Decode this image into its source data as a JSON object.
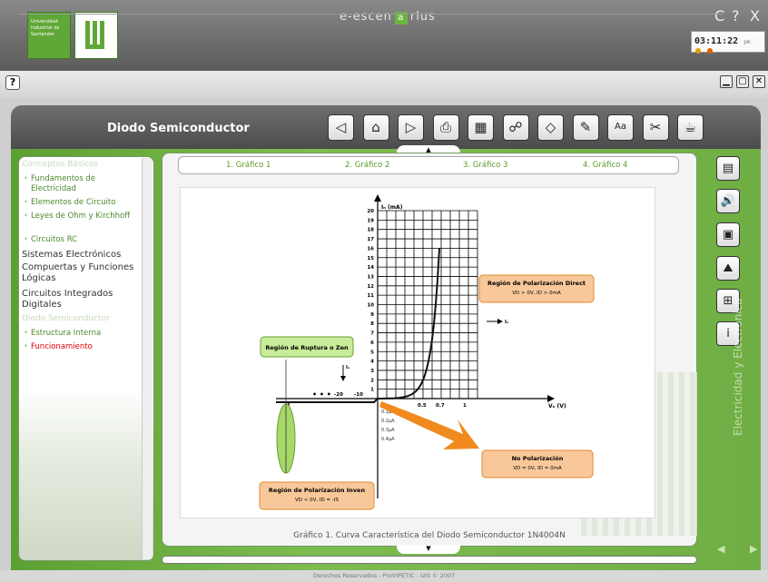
{
  "app": {
    "brand_left": "e-escen",
    "brand_mid": "a",
    "brand_right": "rlus",
    "university": "Universidad Industrial de Santander",
    "clock": "03:11:22",
    "clock_suffix": "pm",
    "help_label": "?",
    "footer": "Derechos Reservados - ProVIPETIC - UIS © 2007"
  },
  "window_controls": {
    "minimize": "C",
    "help": "?",
    "close": "X"
  },
  "titlebar": {
    "title": "Diodo Semiconductor"
  },
  "toolbar": [
    {
      "name": "prev-icon",
      "glyph": "◁"
    },
    {
      "name": "home-icon",
      "glyph": "⌂"
    },
    {
      "name": "next-icon",
      "glyph": "▷"
    },
    {
      "name": "print-icon",
      "glyph": "⎙"
    },
    {
      "name": "calculator-icon",
      "glyph": "▦"
    },
    {
      "name": "network-icon",
      "glyph": "☍"
    },
    {
      "name": "eraser-icon",
      "glyph": "◇"
    },
    {
      "name": "edit-icon",
      "glyph": "✎"
    },
    {
      "name": "text-size-icon",
      "glyph": "Aa"
    },
    {
      "name": "tools-icon",
      "glyph": "✂"
    },
    {
      "name": "coffee-icon",
      "glyph": "☕"
    }
  ],
  "sidebar": {
    "items": [
      {
        "label": "Conceptos Básicos",
        "kind": "head"
      },
      {
        "label": "Fundamentos de Electricidad",
        "kind": "sub"
      },
      {
        "label": "Elementos de Circuito",
        "kind": "sub"
      },
      {
        "label": "Leyes de Ohm y Kirchhoff",
        "kind": "sub"
      },
      {
        "label": "Circuitos RC",
        "kind": "sub"
      },
      {
        "label": "Sistemas Electrónicos",
        "kind": "main"
      },
      {
        "label": "Compuertas y Funciones Lógicas",
        "kind": "main"
      },
      {
        "label": "Circuitos Integrados Digitales",
        "kind": "main"
      },
      {
        "label": "Diodo Semiconductor",
        "kind": "head"
      },
      {
        "label": "Estructura Interna",
        "kind": "sub"
      },
      {
        "label": "Funcionamiento",
        "kind": "sub-active"
      }
    ]
  },
  "tabs": [
    "1. Gráfico 1",
    "2. Gráfico 2",
    "3. Gráfico 3",
    "4. Gráfico 4"
  ],
  "right_tools": [
    {
      "name": "document-icon",
      "glyph": "▤"
    },
    {
      "name": "audio-icon",
      "glyph": "🔊"
    },
    {
      "name": "video-icon",
      "glyph": "▣"
    },
    {
      "name": "image-icon",
      "glyph": "⛰"
    },
    {
      "name": "simulation-icon",
      "glyph": "⊞"
    },
    {
      "name": "info-icon",
      "glyph": "i"
    }
  ],
  "side_label": "Electricidad y Electrónica",
  "chart_data": {
    "type": "line",
    "caption": "Gráfico 1. Curva Característica del Diodo Semiconductor 1N4004N",
    "ylabel": "Iₙ (mA)",
    "xlabel": "Vₙ (V)",
    "y_ticks": [
      1,
      2,
      3,
      4,
      5,
      6,
      7,
      8,
      9,
      10,
      11,
      12,
      13,
      14,
      15,
      16,
      17,
      18,
      19,
      20
    ],
    "x_ticks_pos": [
      "0.5",
      "0.7",
      "1"
    ],
    "x_ticks_neg": [
      "-20",
      "-10"
    ],
    "reverse_currents": [
      "0.1μA",
      "0.2μA",
      "0.3μA",
      "0.4μA"
    ],
    "i_label": "Iₙ",
    "boxes": {
      "forward": {
        "title": "Región de Polarización Direct",
        "detail": "VD > 0V,     ID > 0mA"
      },
      "breakdown": {
        "title": "Región de Ruptura o Zen"
      },
      "reverse": {
        "title": "Región de Polarización Inven",
        "detail": "VD < 0V,     ID = -IS"
      },
      "none": {
        "title": "No Polarización",
        "detail": "VD = 0V,     ID = 0mA"
      }
    },
    "series": [
      {
        "x": [
          -30,
          -20,
          -10,
          0,
          0.3,
          0.5,
          0.6,
          0.65,
          0.7
        ],
        "y": [
          -0.5,
          -0.5,
          -0.5,
          0,
          0.3,
          2,
          6,
          12,
          20
        ]
      }
    ],
    "ylim": [
      0,
      20
    ],
    "xlim": [
      -30,
      1
    ],
    "grid": true
  }
}
